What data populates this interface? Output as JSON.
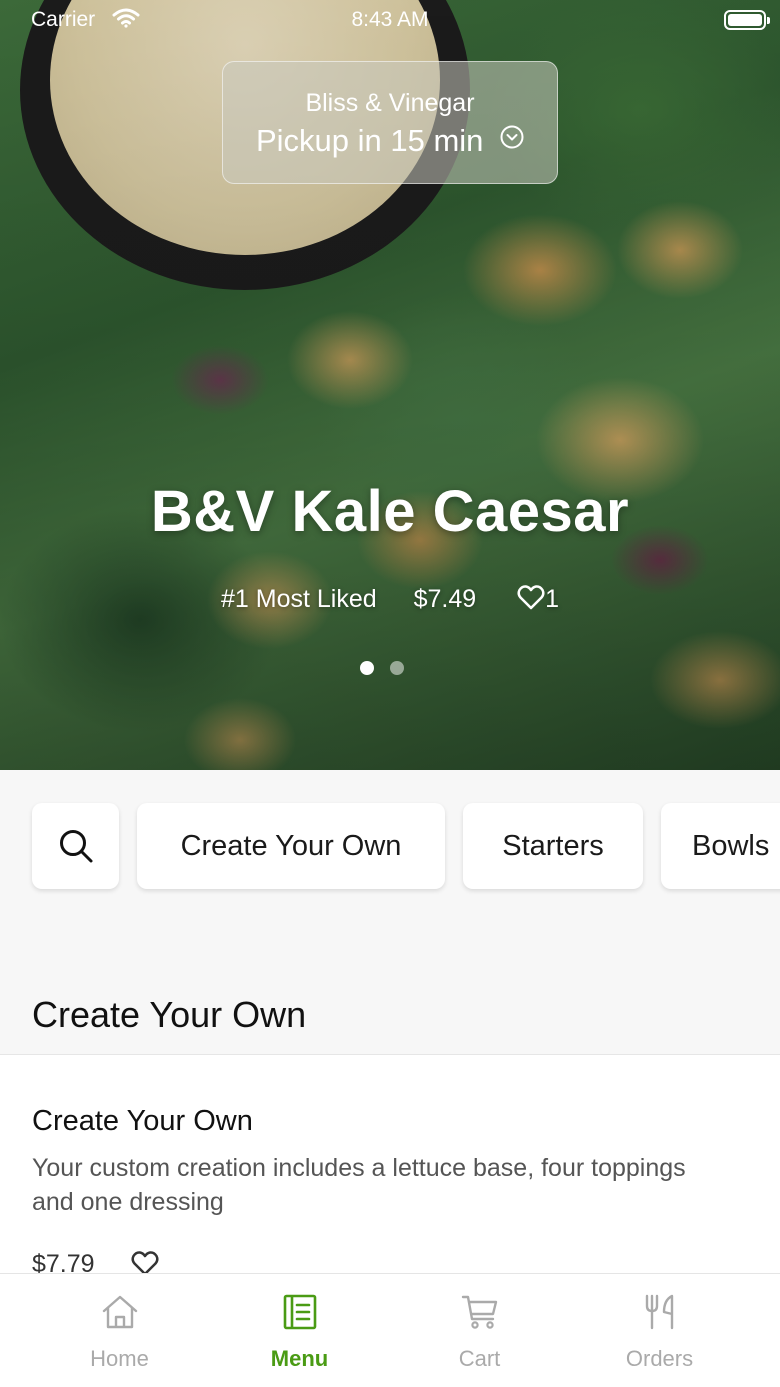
{
  "status_bar": {
    "carrier": "Carrier",
    "time": "8:43 AM"
  },
  "pickup": {
    "store": "Bliss & Vinegar",
    "time_label": "Pickup in 15 min"
  },
  "hero": {
    "title": "B&V Kale Caesar",
    "badge": "#1 Most Liked",
    "price": "$7.49",
    "likes": "1",
    "carousel_pages": 2,
    "carousel_active_index": 0
  },
  "categories": {
    "items": [
      "Create Your Own",
      "Starters",
      "Bowls"
    ]
  },
  "section": {
    "title": "Create Your Own"
  },
  "menu_item": {
    "name": "Create Your Own",
    "description": "Your custom creation includes a lettuce base, four toppings and one dressing",
    "price": "$7.79"
  },
  "tab_bar": {
    "tabs": [
      {
        "label": "Home",
        "icon": "home-icon"
      },
      {
        "label": "Menu",
        "icon": "menu-icon"
      },
      {
        "label": "Cart",
        "icon": "cart-icon"
      },
      {
        "label": "Orders",
        "icon": "utensils-icon"
      }
    ],
    "active_index": 1
  },
  "colors": {
    "accent": "#4a9b14",
    "inactive_tab": "#aaaaaa",
    "background": "#f7f7f7"
  }
}
